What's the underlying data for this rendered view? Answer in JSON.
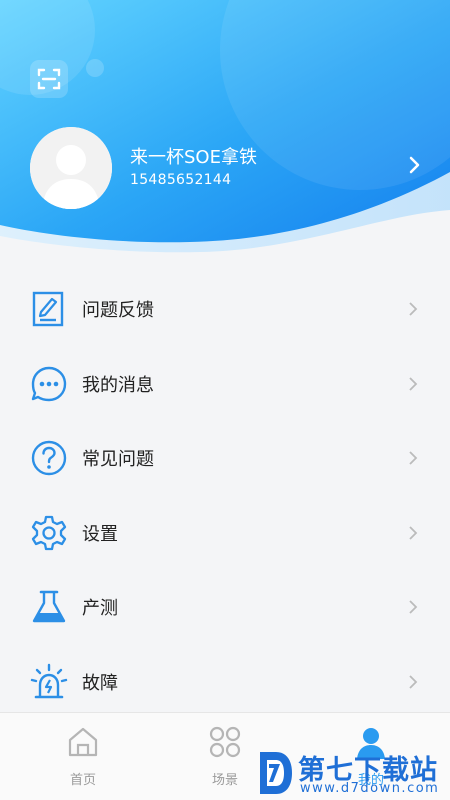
{
  "profile": {
    "name": "来一杯SOE拿铁",
    "phone": "15485652144"
  },
  "menu": [
    {
      "label": "问题反馈",
      "icon": "feedback-document-icon"
    },
    {
      "label": "我的消息",
      "icon": "message-bubble-icon"
    },
    {
      "label": "常见问题",
      "icon": "question-circle-icon"
    },
    {
      "label": "设置",
      "icon": "gear-icon"
    },
    {
      "label": "产测",
      "icon": "flask-icon"
    },
    {
      "label": "故障",
      "icon": "alarm-light-icon"
    }
  ],
  "tabbar": {
    "tabs": [
      {
        "label": "首页",
        "icon": "home-icon",
        "active": false
      },
      {
        "label": "场景",
        "icon": "scene-grid-icon",
        "active": false
      },
      {
        "label": "我的",
        "icon": "person-icon",
        "active": true
      }
    ]
  },
  "watermark": {
    "title": "第七下载站",
    "url": "www.d7down.com"
  },
  "colors": {
    "primary": "#2a9bf0",
    "header_gradient_start": "#5fd0ff",
    "header_gradient_end": "#1a86f0",
    "icon_blue": "#2c8fe6"
  }
}
